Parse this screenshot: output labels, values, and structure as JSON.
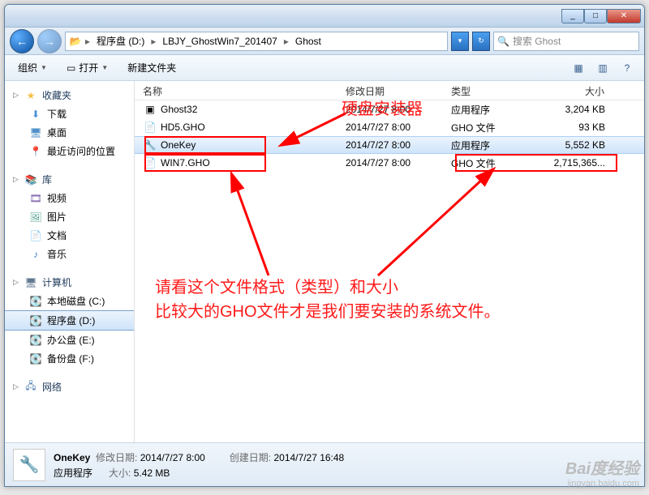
{
  "titlebar": {
    "min": "_",
    "max": "□",
    "close": "✕"
  },
  "address": {
    "back": "←",
    "fwd": "→",
    "icon": "📂",
    "segments": [
      "程序盘 (D:)",
      "LBJY_GhostWin7_201407",
      "Ghost"
    ],
    "sep": "▸",
    "refresh": "↻"
  },
  "search": {
    "placeholder": "搜索 Ghost",
    "icon": "🔍"
  },
  "toolbar": {
    "organize": "组织",
    "open": "打开",
    "newfolder": "新建文件夹",
    "view_icons": "▦",
    "view_help": "?"
  },
  "sidebar": {
    "fav": {
      "label": "收藏夹",
      "items": [
        {
          "label": "下载",
          "icon": "⬇"
        },
        {
          "label": "桌面",
          "icon": "🖥"
        },
        {
          "label": "最近访问的位置",
          "icon": "📍"
        }
      ]
    },
    "lib": {
      "label": "库",
      "items": [
        {
          "label": "视频",
          "icon": "🎞"
        },
        {
          "label": "图片",
          "icon": "🖼"
        },
        {
          "label": "文档",
          "icon": "📄"
        },
        {
          "label": "音乐",
          "icon": "♪"
        }
      ]
    },
    "comp": {
      "label": "计算机",
      "items": [
        {
          "label": "本地磁盘 (C:)",
          "icon": "💽"
        },
        {
          "label": "程序盘 (D:)",
          "icon": "💽",
          "active": true
        },
        {
          "label": "办公盘 (E:)",
          "icon": "💽"
        },
        {
          "label": "备份盘 (F:)",
          "icon": "💽"
        }
      ]
    },
    "net": {
      "label": "网络",
      "icon": "🖧"
    }
  },
  "columns": {
    "name": "名称",
    "date": "修改日期",
    "type": "类型",
    "size": "大小"
  },
  "files": [
    {
      "icon": "▣",
      "name": "Ghost32",
      "date": "2014/7/27 8:00",
      "type": "应用程序",
      "size": "3,204 KB"
    },
    {
      "icon": "📄",
      "name": "HD5.GHO",
      "date": "2014/7/27 8:00",
      "type": "GHO 文件",
      "size": "93 KB"
    },
    {
      "icon": "🔧",
      "name": "OneKey",
      "date": "2014/7/27 8:00",
      "type": "应用程序",
      "size": "5,552 KB",
      "selected": true
    },
    {
      "icon": "📄",
      "name": "WIN7.GHO",
      "date": "2014/7/27 8:00",
      "type": "GHO 文件",
      "size": "2,715,365..."
    }
  ],
  "annotations": {
    "label1": "硬盘安装器",
    "label2_line1": "请看这个文件格式（类型）和大小",
    "label2_line2": "比较大的GHO文件才是我们要安装的系统文件。"
  },
  "details": {
    "name": "OneKey",
    "date_label": "修改日期:",
    "date": "2014/7/27 8:00",
    "created_label": "创建日期:",
    "created": "2014/7/27 16:48",
    "type": "应用程序",
    "size_label": "大小:",
    "size": "5.42 MB"
  },
  "watermark": {
    "main": "Bai度经验",
    "sub": "jingyan.baidu.com"
  }
}
